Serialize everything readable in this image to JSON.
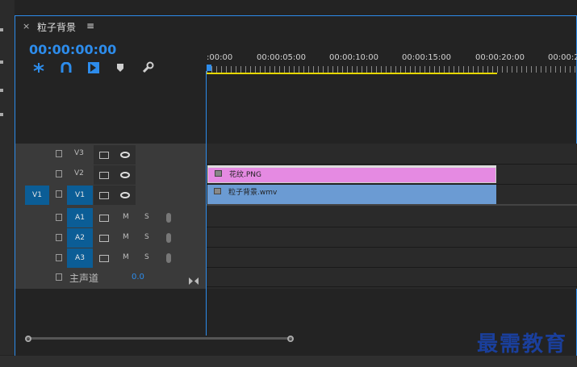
{
  "sequence_tab": {
    "close": "×",
    "title": "粒子背景",
    "menu": "≡"
  },
  "timecode": "00:00:00:00",
  "toolbar_icons": [
    "snap-icon",
    "linked-selection-icon",
    "add-marker-edit-icon",
    "marker-icon",
    "wrench-icon"
  ],
  "ruler": {
    "labels": [
      ":00:00",
      "00:00:05:00",
      "00:00:10:00",
      "00:00:15:00",
      "00:00:20:00",
      "00:00:2"
    ]
  },
  "tracks": {
    "video": [
      {
        "name": "V3",
        "source": ""
      },
      {
        "name": "V2",
        "source": ""
      },
      {
        "name": "V1",
        "source": "V1"
      }
    ],
    "audio": [
      {
        "name": "A1",
        "mute": "M",
        "solo": "S"
      },
      {
        "name": "A2",
        "mute": "M",
        "solo": "S"
      },
      {
        "name": "A3",
        "mute": "M",
        "solo": "S"
      }
    ],
    "master": {
      "label": "主声道",
      "value": "0.0"
    }
  },
  "clips": {
    "v2": {
      "fx": "fx",
      "name": "花纹.PNG"
    },
    "v1": {
      "fx": "fx",
      "name": "粒子背景.wmv"
    }
  },
  "watermark": "最需教育",
  "colors": {
    "accent": "#2d8ceb",
    "clip_v2": "#e58ae2",
    "clip_v1": "#6b9bd3",
    "badge": "#0b5d96",
    "work_area": "#e6d800"
  }
}
